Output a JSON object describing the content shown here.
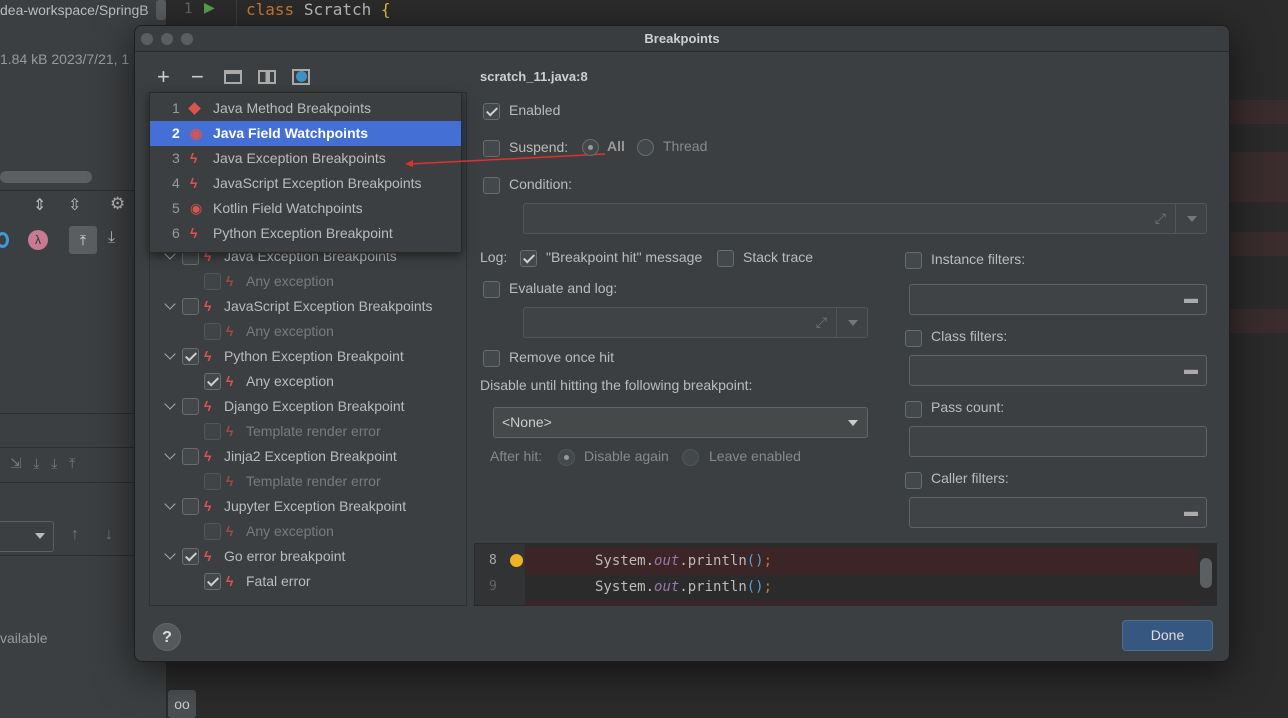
{
  "background": {
    "project_path": "dea-workspace/SpringB",
    "file_info": "1.84 kB 2023/7/21, 1",
    "code_line_number": "1",
    "code_keyword": "class",
    "code_class": "Scratch",
    "code_brace": "{",
    "unavailable_text": "vailable"
  },
  "dialog": {
    "title": "Breakpoints",
    "toolbar": {
      "add": "+",
      "remove": "−"
    },
    "popup_items": [
      {
        "num": "1",
        "icon": "diamond-icon",
        "label": "Java Method Breakpoints"
      },
      {
        "num": "2",
        "icon": "eye-icon",
        "label": "Java Field Watchpoints",
        "selected": true
      },
      {
        "num": "3",
        "icon": "bolt-icon",
        "label": "Java Exception Breakpoints"
      },
      {
        "num": "4",
        "icon": "bolt-icon",
        "label": "JavaScript Exception Breakpoints"
      },
      {
        "num": "5",
        "icon": "eye-icon",
        "label": "Kotlin Field Watchpoints"
      },
      {
        "num": "6",
        "icon": "bolt-icon",
        "label": "Python Exception Breakpoint"
      }
    ],
    "tree": [
      {
        "level": 0,
        "checked": false,
        "label": "Java Exception Breakpoints"
      },
      {
        "level": 1,
        "checked": false,
        "label": "Any exception",
        "disabled": true
      },
      {
        "level": 0,
        "checked": false,
        "label": "JavaScript Exception Breakpoints"
      },
      {
        "level": 1,
        "checked": false,
        "label": "Any exception",
        "disabled": true
      },
      {
        "level": 0,
        "checked": true,
        "label": "Python Exception Breakpoint"
      },
      {
        "level": 1,
        "checked": true,
        "label": "Any exception"
      },
      {
        "level": 0,
        "checked": false,
        "label": "Django Exception Breakpoint"
      },
      {
        "level": 1,
        "checked": false,
        "label": "Template render error",
        "disabled": true
      },
      {
        "level": 0,
        "checked": false,
        "label": "Jinja2 Exception Breakpoint"
      },
      {
        "level": 1,
        "checked": false,
        "label": "Template render error",
        "disabled": true
      },
      {
        "level": 0,
        "checked": false,
        "label": "Jupyter Exception Breakpoint"
      },
      {
        "level": 1,
        "checked": false,
        "label": "Any exception",
        "disabled": true
      },
      {
        "level": 0,
        "checked": true,
        "label": "Go error breakpoint"
      },
      {
        "level": 1,
        "checked": true,
        "label": "Fatal error"
      }
    ],
    "details": {
      "header": "scratch_11.java:8",
      "enabled": "Enabled",
      "suspend": "Suspend:",
      "suspend_all": "All",
      "suspend_thread": "Thread",
      "condition": "Condition:",
      "log": "Log:",
      "log_message": "\"Breakpoint hit\" message",
      "stack_trace": "Stack trace",
      "evaluate_and_log": "Evaluate and log:",
      "remove_once_hit": "Remove once hit",
      "disable_until": "Disable until hitting the following breakpoint:",
      "disable_until_value": "<None>",
      "after_hit": "After hit:",
      "disable_again": "Disable again",
      "leave_enabled": "Leave enabled",
      "instance_filters": "Instance filters:",
      "class_filters": "Class filters:",
      "pass_count": "Pass count:",
      "caller_filters": "Caller filters:"
    },
    "code_preview": [
      {
        "line": "8",
        "text_a": "System.",
        "text_b": "out",
        "text_c": ".println",
        "text_d": "()",
        "text_e": ";"
      },
      {
        "line": "9",
        "text_a": "System.",
        "text_b": "out",
        "text_c": ".println",
        "text_d": "()",
        "text_e": ";"
      }
    ],
    "help": "?",
    "done": "Done"
  },
  "colors": {
    "selection": "#4470d6",
    "breakpoint": "#f0b323",
    "bolt": "#e0524f",
    "done": "#365880"
  }
}
